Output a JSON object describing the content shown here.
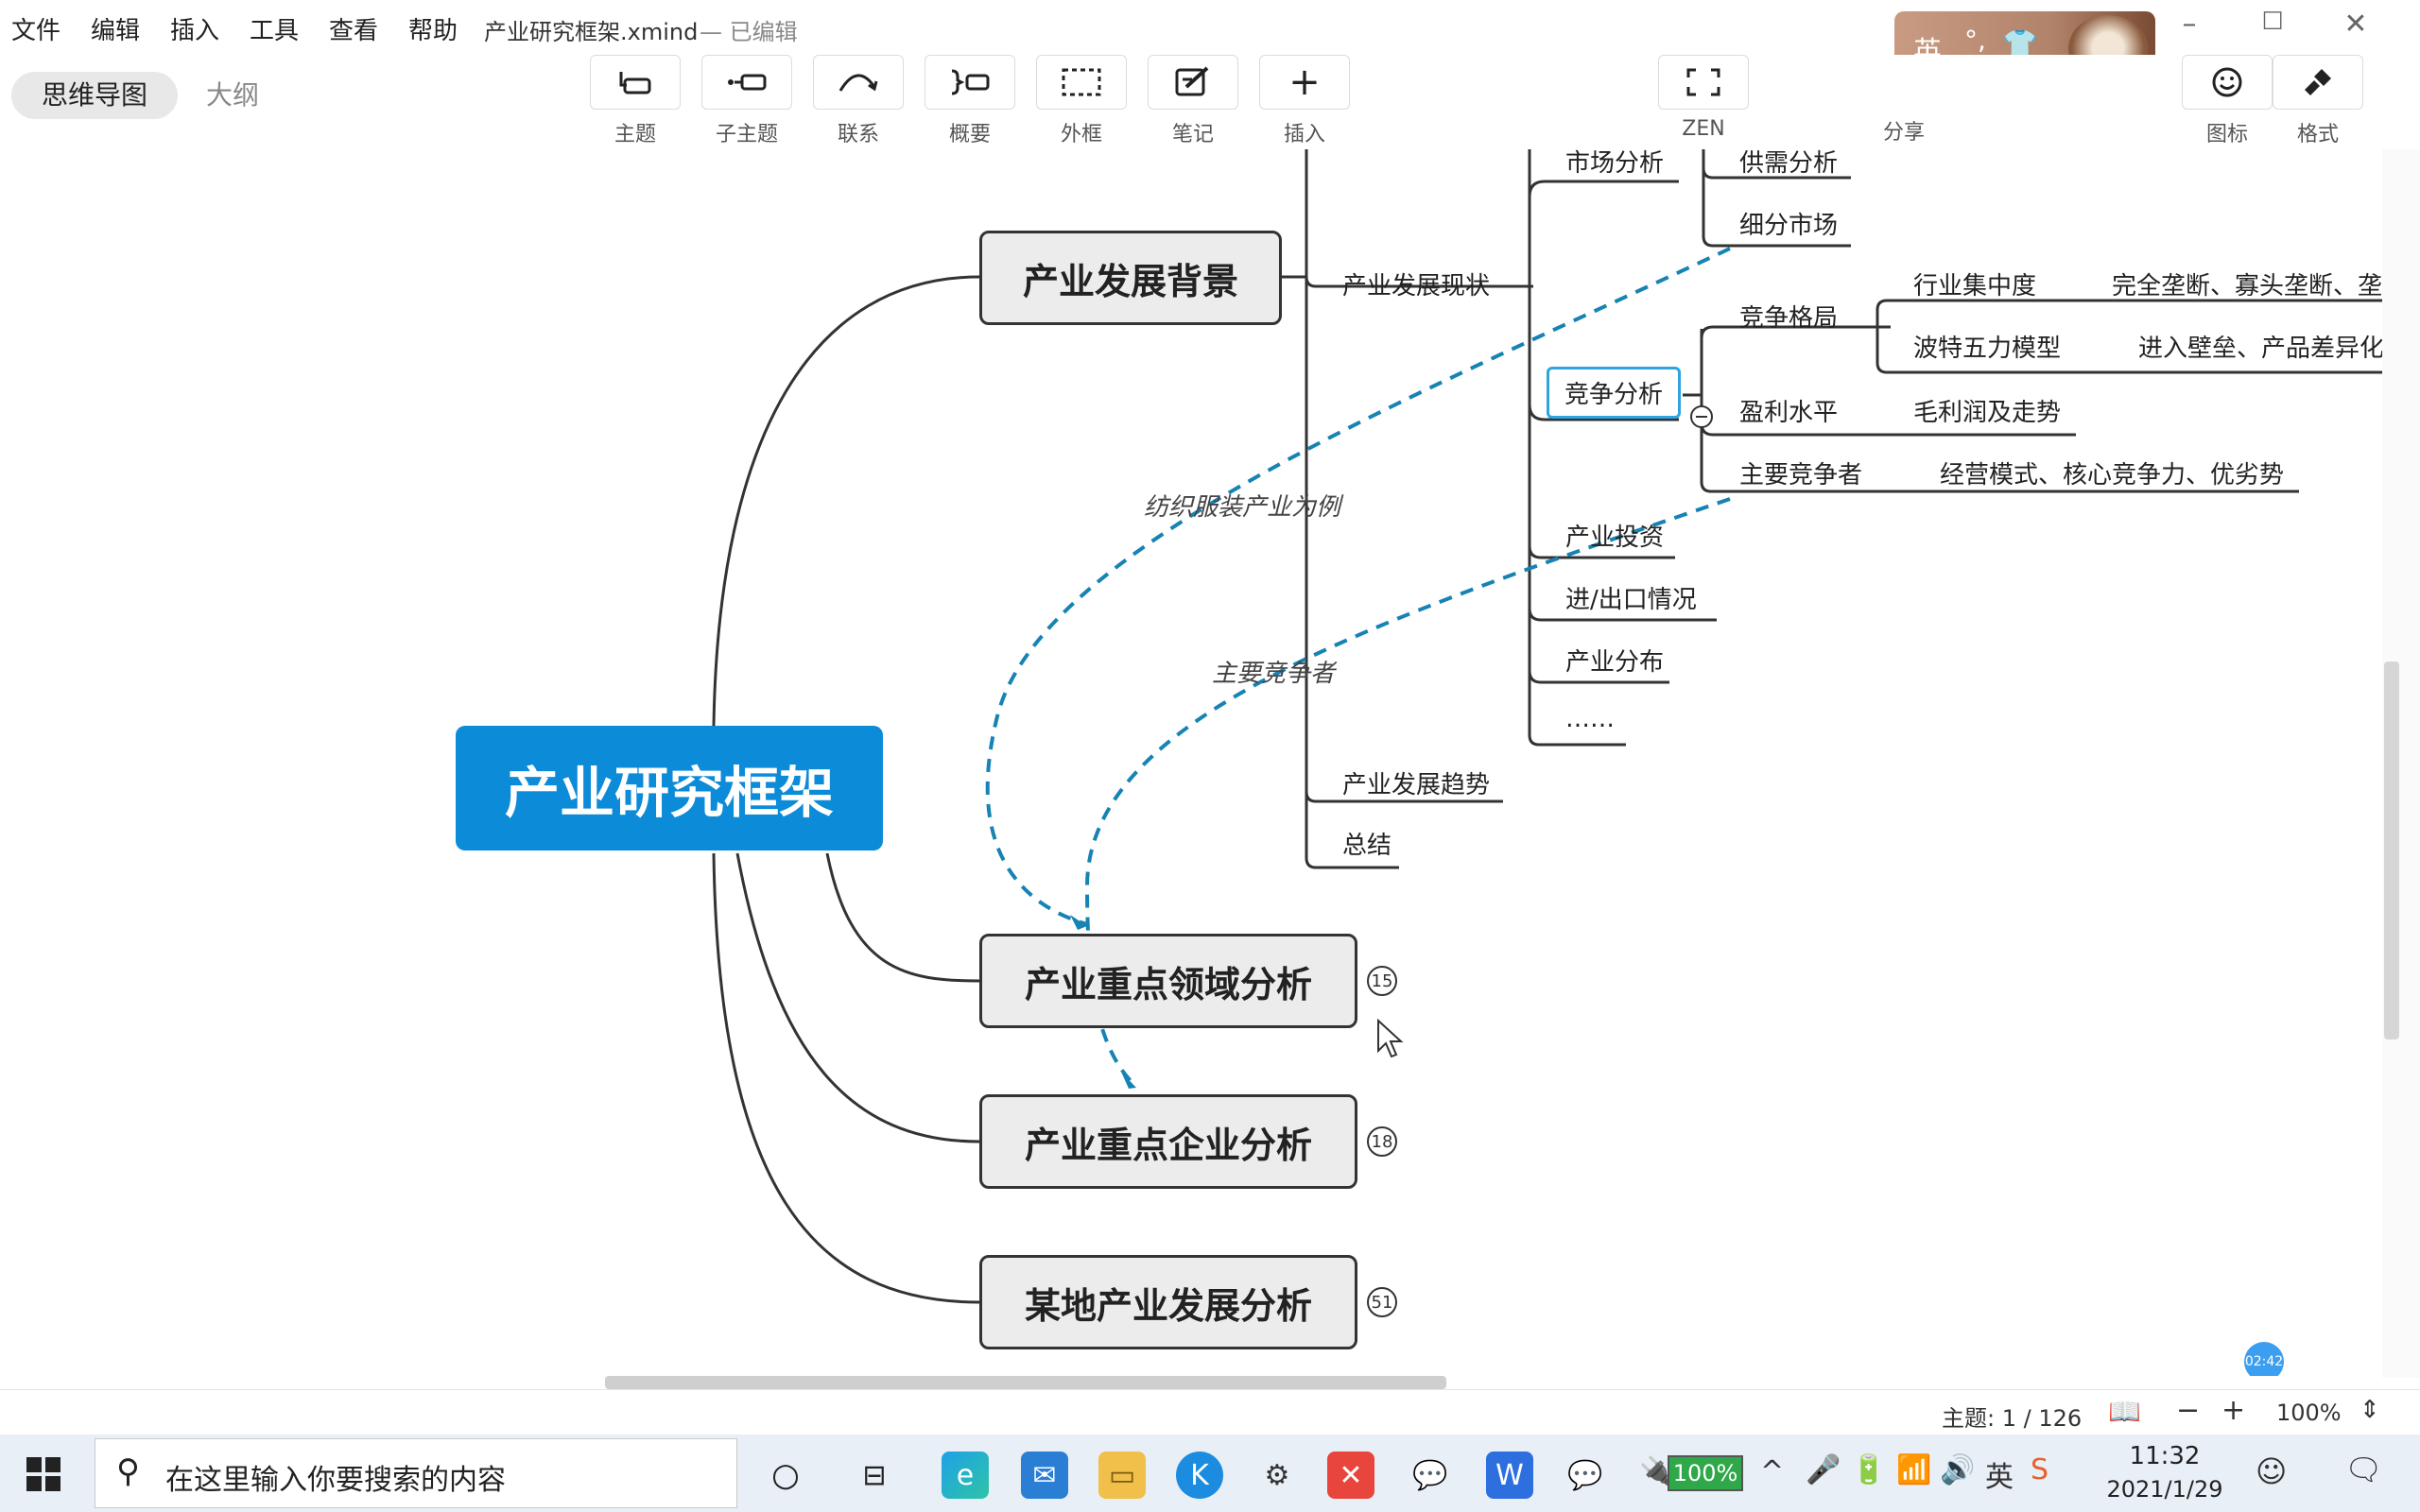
{
  "menubar": {
    "items": [
      "文件",
      "编辑",
      "插入",
      "工具",
      "查看",
      "帮助"
    ],
    "doc_title": "产业研究框架.xmind",
    "doc_status": "— 已编辑"
  },
  "toolbar": {
    "view_tabs": [
      "思维导图",
      "大纲"
    ],
    "tools": [
      {
        "label": "主题",
        "icon": "topic-icon"
      },
      {
        "label": "子主题",
        "icon": "subtopic-icon"
      },
      {
        "label": "联系",
        "icon": "relationship-icon"
      },
      {
        "label": "概要",
        "icon": "summary-icon"
      },
      {
        "label": "外框",
        "icon": "boundary-icon"
      },
      {
        "label": "笔记",
        "icon": "note-icon"
      },
      {
        "label": "插入",
        "icon": "plus-icon"
      }
    ],
    "zen_label": "ZEN",
    "share_label": "分享",
    "icon_label": "图标",
    "format_label": "格式"
  },
  "ime": {
    "lang": "英",
    "punct": "°,"
  },
  "mindmap": {
    "root": "产业研究框架",
    "main_topics": [
      {
        "label": "产业发展背景"
      },
      {
        "label": "产业重点领域分析",
        "badge": "15"
      },
      {
        "label": "产业重点企业分析",
        "badge": "18"
      },
      {
        "label": "某地产业发展分析",
        "badge": "51"
      }
    ],
    "level2": [
      "产业发展现状",
      "产业发展趋势",
      "总结"
    ],
    "level3": [
      "市场分析",
      "竞争分析",
      "产业投资",
      "进/出口情况",
      "产业分布",
      "……"
    ],
    "market_children": [
      "供需分析",
      "细分市场"
    ],
    "competition_children": [
      "竞争格局",
      "盈利水平",
      "主要竞争者"
    ],
    "pattern_children": [
      "行业集中度",
      "波特五力模型"
    ],
    "level6": [
      "完全垄断、寡头垄断、垄",
      "进入壁垒、产品差异化",
      "毛利润及走势",
      "经营模式、核心竞争力、优劣势"
    ],
    "relationship_labels": [
      "纺织服装产业为例",
      "主要竞争者"
    ]
  },
  "statusbar": {
    "topic_count": "主题: 1 / 126",
    "zoom": "100%",
    "timer": "02:42"
  },
  "taskbar": {
    "search_placeholder": "在这里输入你要搜索的内容",
    "battery": "100%",
    "time": "11:32",
    "date": "2021/1/29"
  }
}
